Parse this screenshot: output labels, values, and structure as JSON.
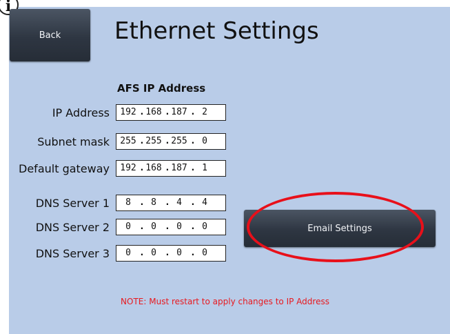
{
  "header": {
    "back_label": "Back",
    "title": "Ethernet Settings",
    "info_glyph": "i"
  },
  "section": {
    "heading": "AFS IP Address"
  },
  "fields": [
    {
      "label": "IP Address",
      "octets": [
        "192",
        "168",
        "187",
        "2"
      ]
    },
    {
      "label": "Subnet mask",
      "octets": [
        "255",
        "255",
        "255",
        "0"
      ]
    },
    {
      "label": "Default gateway",
      "octets": [
        "192",
        "168",
        "187",
        "1"
      ]
    },
    {
      "label": "DNS Server 1",
      "octets": [
        "8",
        "8",
        "4",
        "4"
      ]
    },
    {
      "label": "DNS Server 2",
      "octets": [
        "0",
        "0",
        "0",
        "0"
      ]
    },
    {
      "label": "DNS Server 3",
      "octets": [
        "0",
        "0",
        "0",
        "0"
      ]
    }
  ],
  "separator": ".",
  "email_settings_label": "Email Settings",
  "note": "NOTE: Must restart to apply changes to IP Address",
  "colors": {
    "panel_background": "#b9cce8",
    "button_dark": "#2e3642",
    "note_red": "#e8191f",
    "annotation_ellipse": "#e8101a"
  },
  "icons": {
    "info": "info-icon"
  }
}
